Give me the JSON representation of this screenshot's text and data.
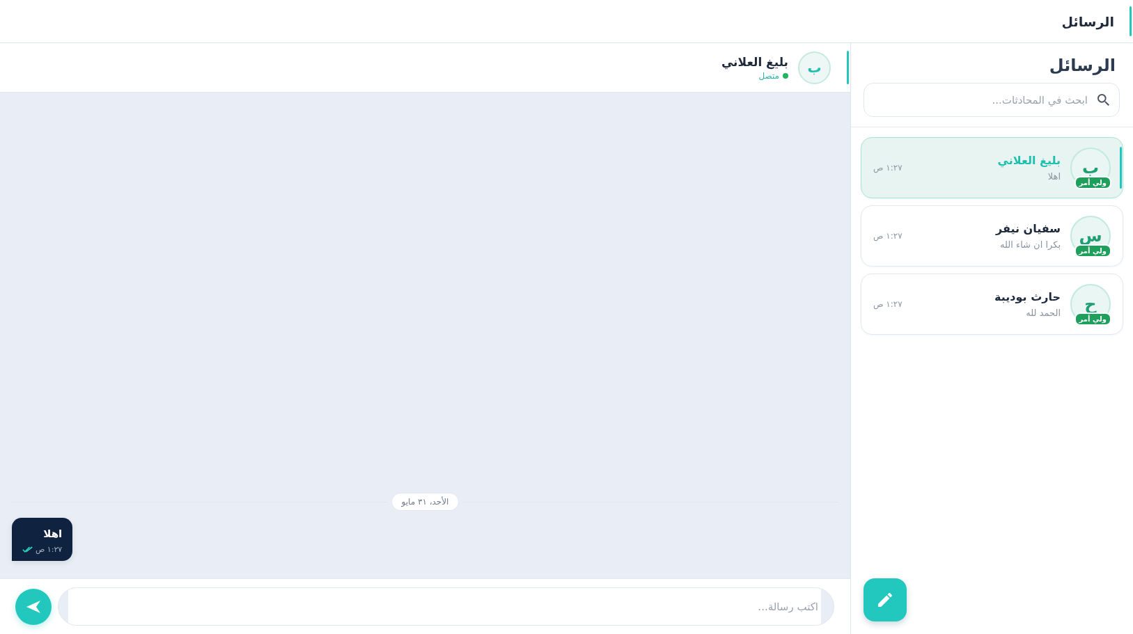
{
  "header": {
    "title": "الرسائل"
  },
  "sidebar": {
    "title": "الرسائل",
    "search": {
      "placeholder": "ابحث في المحادثات..."
    },
    "conversations": [
      {
        "initial": "ب",
        "name": "بليغ العلاني",
        "preview": "اهلا",
        "time": "١:٢٧ ص",
        "badge": "ولي أمر",
        "selected": true
      },
      {
        "initial": "س",
        "name": "سفيان نيفر",
        "preview": "بكرا ان شاء الله",
        "time": "١:٢٧ ص",
        "badge": "ولي أمر",
        "selected": false
      },
      {
        "initial": "ح",
        "name": "حارث بوديبة",
        "preview": "الحمد لله",
        "time": "١:٢٧ ص",
        "badge": "ولي أمر",
        "selected": false
      }
    ]
  },
  "chat": {
    "contact": {
      "initial": "ب",
      "name": "بليغ العلاني",
      "status": "متصل",
      "online": true
    },
    "date_separator": "الأحد، ٣١ مايو",
    "messages": [
      {
        "text": "اهلا",
        "time": "١:٢٧ ص",
        "outgoing": true,
        "read": true
      }
    ],
    "composer": {
      "placeholder": "اكتب رسالة..."
    }
  }
}
